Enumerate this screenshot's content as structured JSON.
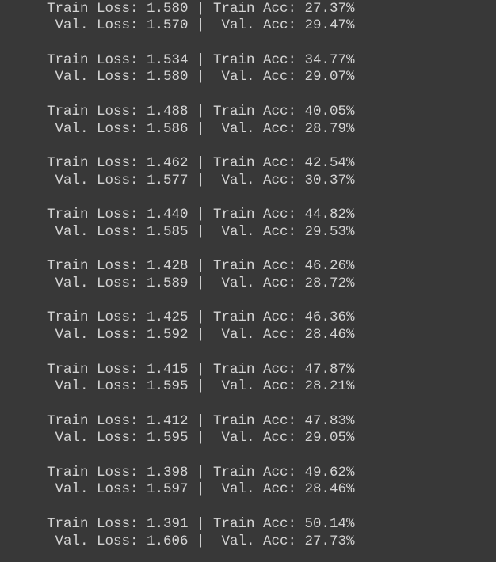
{
  "output": {
    "lines": [
      "Train Loss: 1.580 | Train Acc: 27.37%",
      " Val. Loss: 1.570 |  Val. Acc: 29.47%",
      "Train Loss: 1.534 | Train Acc: 34.77%",
      " Val. Loss: 1.580 |  Val. Acc: 29.07%",
      "Train Loss: 1.488 | Train Acc: 40.05%",
      " Val. Loss: 1.586 |  Val. Acc: 28.79%",
      "Train Loss: 1.462 | Train Acc: 42.54%",
      " Val. Loss: 1.577 |  Val. Acc: 30.37%",
      "Train Loss: 1.440 | Train Acc: 44.82%",
      " Val. Loss: 1.585 |  Val. Acc: 29.53%",
      "Train Loss: 1.428 | Train Acc: 46.26%",
      " Val. Loss: 1.589 |  Val. Acc: 28.72%",
      "Train Loss: 1.425 | Train Acc: 46.36%",
      " Val. Loss: 1.592 |  Val. Acc: 28.46%",
      "Train Loss: 1.415 | Train Acc: 47.87%",
      " Val. Loss: 1.595 |  Val. Acc: 28.21%",
      "Train Loss: 1.412 | Train Acc: 47.83%",
      " Val. Loss: 1.595 |  Val. Acc: 29.05%",
      "Train Loss: 1.398 | Train Acc: 49.62%",
      " Val. Loss: 1.597 |  Val. Acc: 28.46%",
      "Train Loss: 1.391 | Train Acc: 50.14%",
      " Val. Loss: 1.606 |  Val. Acc: 27.73%"
    ]
  }
}
